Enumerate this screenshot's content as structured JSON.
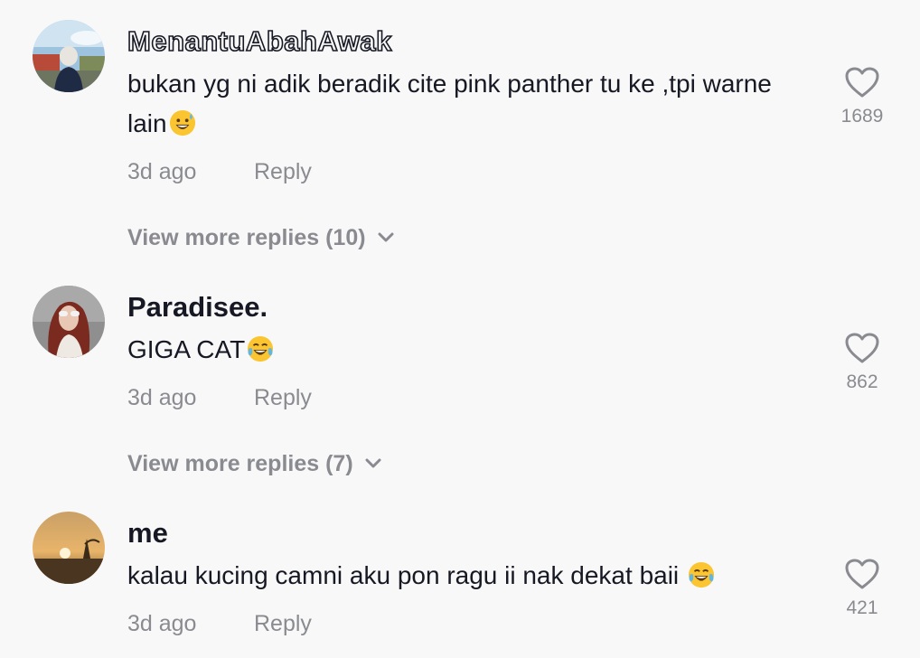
{
  "comments": [
    {
      "username": "MenantuAbahAwak",
      "text": "bukan yg ni adik beradik cite pink panther tu ke ,tpi warne lain",
      "emoji": "grinning-sweat-emoji",
      "time": "3d ago",
      "reply_label": "Reply",
      "likes": "1689",
      "view_more": "View more replies (10)"
    },
    {
      "username": "Paradisee.",
      "text": "GIGA CAT",
      "emoji": "tears-of-joy-emoji",
      "time": "3d ago",
      "reply_label": "Reply",
      "likes": "862",
      "view_more": "View more replies (7)"
    },
    {
      "username": "me",
      "text": "kalau kucing camni aku pon ragu ii nak dekat baii ",
      "emoji": "tears-of-joy-emoji",
      "time": "3d ago",
      "reply_label": "Reply",
      "likes": "421"
    }
  ],
  "colors": {
    "background": "#f8f8f8",
    "primary_text": "#161823",
    "secondary_text": "#8a8b91",
    "emoji_yellow": "#fbc531"
  }
}
